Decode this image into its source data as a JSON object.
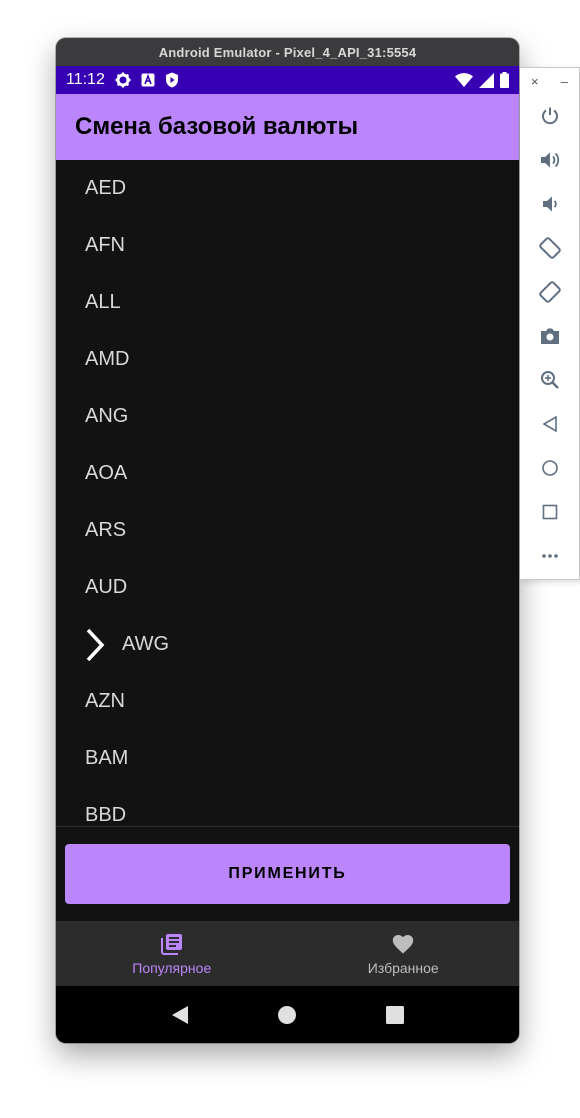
{
  "window": {
    "title": "Android Emulator - Pixel_4_API_31:5554"
  },
  "status_bar": {
    "time": "11:12",
    "left_icons": [
      "gear-icon",
      "font-a-icon",
      "shield-play-icon"
    ],
    "right_icons": [
      "wifi-icon",
      "cell-signal-icon",
      "battery-icon"
    ]
  },
  "app_bar": {
    "title": "Смена базовой валюты"
  },
  "currency_list": {
    "items": [
      "AED",
      "AFN",
      "ALL",
      "AMD",
      "ANG",
      "AOA",
      "ARS",
      "AUD",
      "AWG",
      "AZN",
      "BAM",
      "BBD"
    ],
    "selected": "AWG"
  },
  "apply_button": {
    "label": "ПРИМЕНИТЬ"
  },
  "bottom_nav": {
    "items": [
      {
        "label": "Популярное",
        "icon": "library-icon",
        "active": true
      },
      {
        "label": "Избранное",
        "icon": "heart-icon",
        "active": false
      }
    ]
  },
  "system_nav": [
    "back-icon",
    "home-icon",
    "recents-icon"
  ],
  "side_toolbar": {
    "top_controls": [
      "×",
      "–"
    ],
    "buttons": [
      "power-icon",
      "volume-up-icon",
      "volume-down-icon",
      "rotate-left-icon",
      "rotate-right-icon",
      "camera-icon",
      "zoom-icon",
      "back-icon",
      "home-icon",
      "overview-icon",
      "more-icon"
    ]
  },
  "colors": {
    "primary": "#bb86fc",
    "status_bar": "#3700b3",
    "background": "#121212",
    "bottom_nav": "#2c2c2c"
  }
}
